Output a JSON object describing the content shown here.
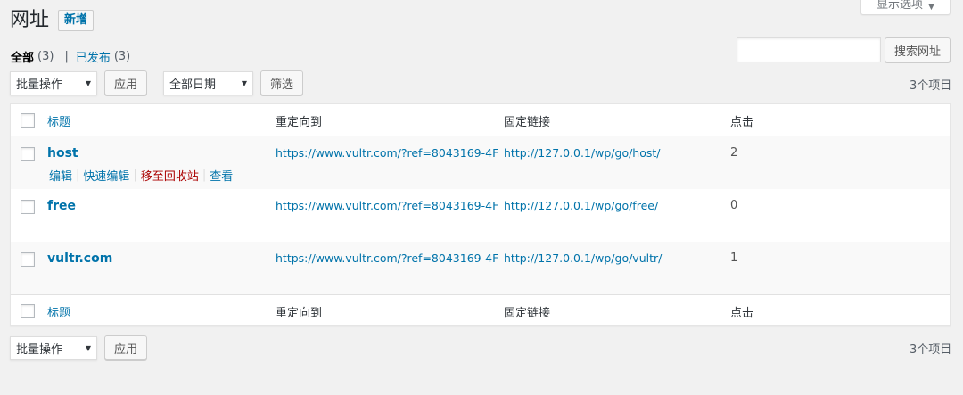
{
  "screen_options": {
    "label": "显示选项"
  },
  "header": {
    "title": "网址",
    "add_new": "新增"
  },
  "filters": {
    "all_label": "全部",
    "all_count": "(3)",
    "separator": "|",
    "published_label": "已发布",
    "published_count": "(3)"
  },
  "search": {
    "value": "",
    "button": "搜索网址"
  },
  "tablenav_top": {
    "bulk_select": "批量操作",
    "apply": "应用",
    "date_select": "全部日期",
    "filter": "筛选",
    "items_count": "3个项目"
  },
  "tablenav_bottom": {
    "bulk_select": "批量操作",
    "apply": "应用",
    "items_count": "3个项目"
  },
  "table": {
    "columns": {
      "title": "标题",
      "redirect": "重定向到",
      "permalink": "固定链接",
      "clicks": "点击"
    },
    "rows": [
      {
        "title": "host",
        "redirect": "https://www.vultr.com/?ref=8043169-4F",
        "permalink": "http://127.0.0.1/wp/go/host/",
        "clicks": "2"
      },
      {
        "title": "free",
        "redirect": "https://www.vultr.com/?ref=8043169-4F",
        "permalink": "http://127.0.0.1/wp/go/free/",
        "clicks": "0"
      },
      {
        "title": "vultr.com",
        "redirect": "https://www.vultr.com/?ref=8043169-4F",
        "permalink": "http://127.0.0.1/wp/go/vultr/",
        "clicks": "1"
      }
    ],
    "row_actions": {
      "edit": "编辑",
      "quick_edit": "快速编辑",
      "trash": "移至回收站",
      "view": "查看",
      "pipe": "|"
    }
  }
}
